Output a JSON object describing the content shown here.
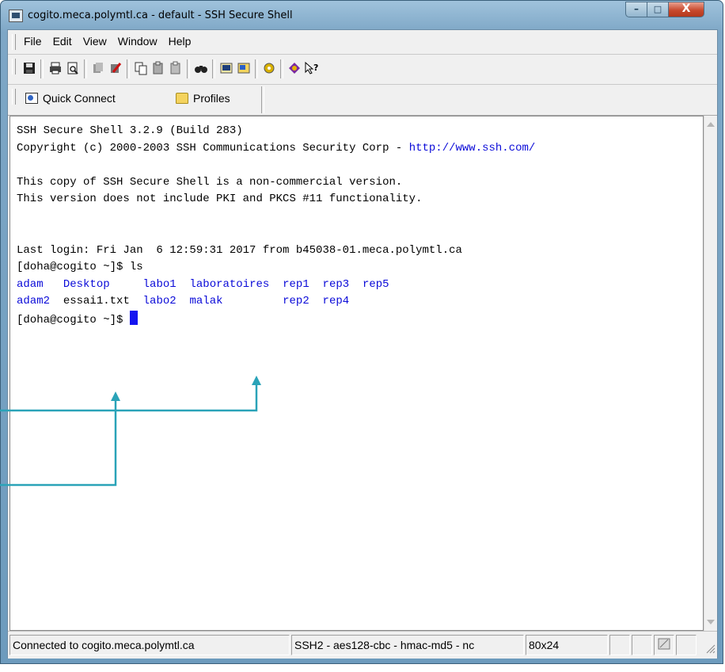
{
  "window": {
    "title": "cogito.meca.polymtl.ca - default - SSH Secure Shell",
    "controls": {
      "minimize": "–",
      "maximize": "□",
      "close": "X"
    }
  },
  "menu": [
    "File",
    "Edit",
    "View",
    "Window",
    "Help"
  ],
  "toolbar_icons": [
    "save-icon",
    "print-icon",
    "print-preview-icon",
    "disconnect-icon",
    "settings-icon",
    "copy-icon",
    "paste-icon",
    "paste-alt-icon",
    "find-icon",
    "new-terminal-icon",
    "file-transfer-icon",
    "settings-gear-icon",
    "help-icon",
    "whats-this-icon"
  ],
  "quickbar": {
    "quick_connect": "Quick Connect",
    "profiles": "Profiles"
  },
  "terminal": {
    "lines": [
      "SSH Secure Shell 3.2.9 (Build 283)",
      "Copyright (c) 2000-2003 SSH Communications Security Corp - ",
      "",
      "This copy of SSH Secure Shell is a non-commercial version.",
      "This version does not include PKI and PKCS #11 functionality.",
      "",
      "",
      "Last login: Fri Jan  6 12:59:31 2017 from b45038-01.meca.polymtl.ca",
      "[doha@cogito ~]$ ls"
    ],
    "url": "http://www.ssh.com/",
    "ls_row1": [
      "adam",
      "Desktop",
      "labo1",
      "laboratoires",
      "rep1",
      "rep3",
      "rep5"
    ],
    "ls_row2": [
      "adam2",
      "essai1.txt",
      "labo2",
      "malak",
      "rep2",
      "rep4"
    ],
    "prompt": "[doha@cogito ~]$ "
  },
  "statusbar": {
    "connection": "Connected to cogito.meca.polymtl.ca",
    "protocol": "SSH2 - aes128-cbc - hmac-md5 - nc",
    "size": "80x24"
  },
  "colors": {
    "directory": "#0a0ad8",
    "annotation": "#2aa3b8",
    "cursor": "#1414f0"
  }
}
